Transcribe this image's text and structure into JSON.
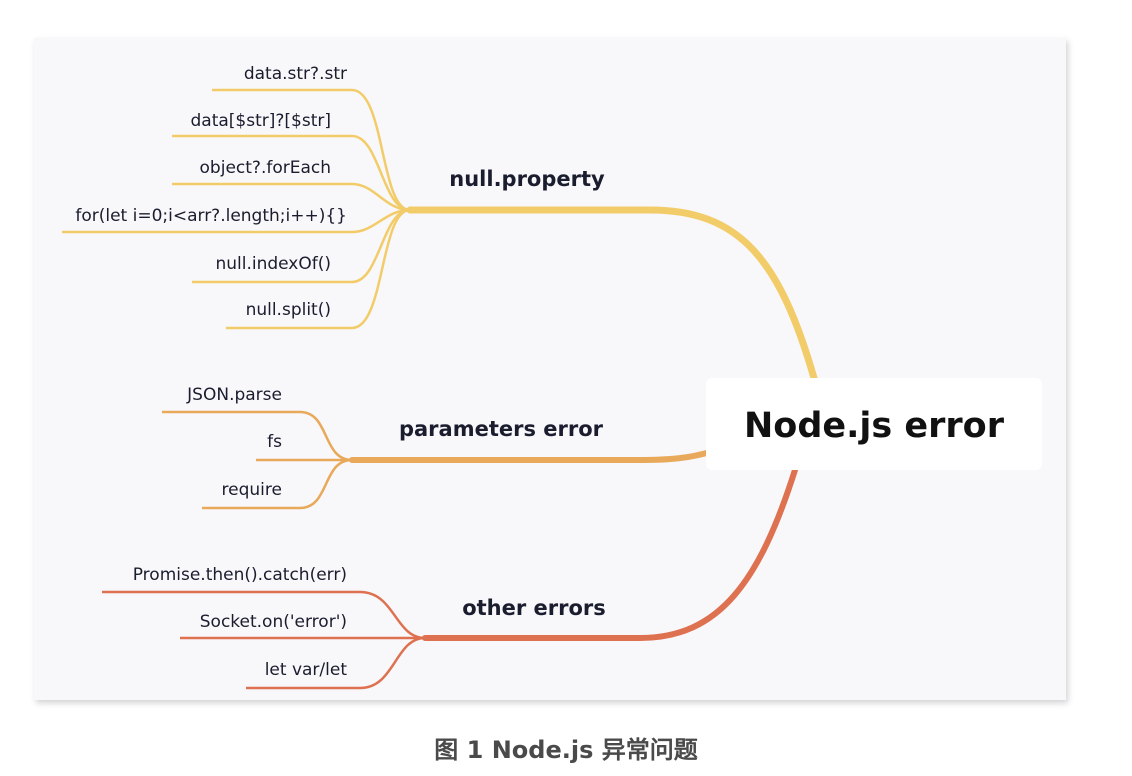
{
  "diagram": {
    "root": {
      "label": "Node.js error"
    },
    "branches": [
      {
        "id": "null-property",
        "label": "null.property",
        "color": "#f3cc6a",
        "leaves": [
          "data.str?.str",
          "data[$str]?[$str]",
          "object?.forEach",
          "for(let i=0;i<arr?.length;i++){}",
          "null.indexOf()",
          "null.split()"
        ]
      },
      {
        "id": "parameters-error",
        "label": "parameters error",
        "color": "#e8a95a",
        "leaves": [
          "JSON.parse",
          "fs",
          "require"
        ]
      },
      {
        "id": "other-errors",
        "label": "other errors",
        "color": "#dd7150",
        "leaves": [
          "Promise.then().catch(err)",
          "Socket.on('error')",
          "let var/let"
        ]
      }
    ]
  },
  "caption": "图 1 Node.js 异常问题"
}
